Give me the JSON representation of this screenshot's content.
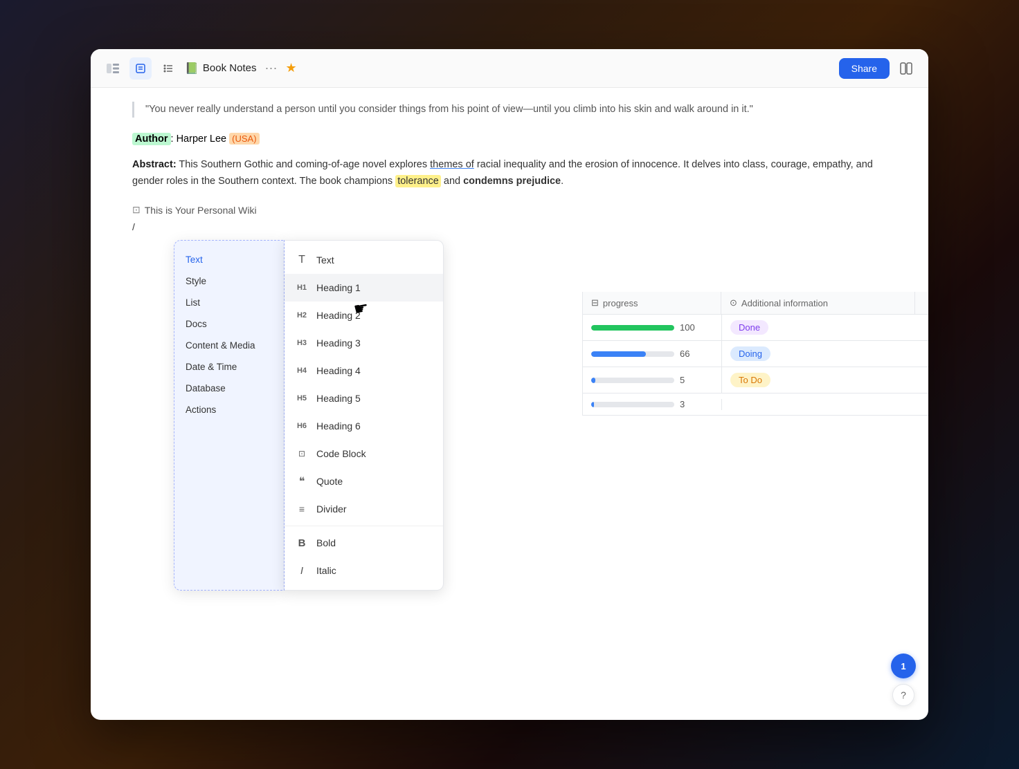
{
  "window": {
    "title": "Book Notes"
  },
  "titlebar": {
    "sidebar_toggle_label": "☰",
    "doc_icon": "📗",
    "doc_title": "Book Notes",
    "more_label": "···",
    "star_label": "★",
    "share_label": "Share",
    "layout_label": "⊡"
  },
  "content": {
    "quote_text": "\"You never really understand a person until you consider things from his point of view—until you climb into his skin and walk around in it.\"",
    "author_label": "Author",
    "author_name": "Harper Lee",
    "author_tag": "(USA)",
    "abstract_label": "Abstract",
    "abstract_text": "This Southern Gothic and coming-of-age novel explores themes of racial inequality and the erosion of innocence. It delves into class, courage, empathy, and gender roles in the Southern context. The book champions tolerance and condemns prejudice.",
    "themes_of": "themes of",
    "tolerance": "tolerance",
    "condemns_prejudice": "condemns prejudice",
    "wiki_ref_icon": "⊡",
    "wiki_ref_text": "This is Your Personal Wiki",
    "slash_command": "/"
  },
  "table": {
    "progress_col": "progress",
    "info_col": "Additional information",
    "rows": [
      {
        "progress": 100,
        "progress_color": "#22c55e",
        "status": "Done",
        "status_class": "badge-done"
      },
      {
        "progress": 66,
        "progress_color": "#3b82f6",
        "status": "Doing",
        "status_class": "badge-doing"
      },
      {
        "progress": 5,
        "progress_color": "#3b82f6",
        "status": "To Do",
        "status_class": "badge-todo"
      },
      {
        "progress": 3,
        "progress_color": "#3b82f6",
        "status": "",
        "status_class": ""
      }
    ]
  },
  "menu": {
    "categories": [
      {
        "id": "text",
        "label": "Text",
        "active": true
      },
      {
        "id": "style",
        "label": "Style",
        "active": false
      },
      {
        "id": "list",
        "label": "List",
        "active": false
      },
      {
        "id": "docs",
        "label": "Docs",
        "active": false
      },
      {
        "id": "content_media",
        "label": "Content & Media",
        "active": false
      },
      {
        "id": "date_time",
        "label": "Date & Time",
        "active": false
      },
      {
        "id": "database",
        "label": "Database",
        "active": false
      },
      {
        "id": "actions",
        "label": "Actions",
        "active": false
      }
    ],
    "items": [
      {
        "icon": "T",
        "label": "Text",
        "highlighted": false
      },
      {
        "icon": "H1",
        "label": "Heading 1",
        "highlighted": true
      },
      {
        "icon": "H2",
        "label": "Heading 2",
        "highlighted": false
      },
      {
        "icon": "H3",
        "label": "Heading 3",
        "highlighted": false
      },
      {
        "icon": "H4",
        "label": "Heading 4",
        "highlighted": false
      },
      {
        "icon": "H5",
        "label": "Heading 5",
        "highlighted": false
      },
      {
        "icon": "H6",
        "label": "Heading 6",
        "highlighted": false
      },
      {
        "icon": "{ }",
        "label": "Code Block",
        "highlighted": false
      },
      {
        "icon": "❝",
        "label": "Quote",
        "highlighted": false
      },
      {
        "icon": "—",
        "label": "Divider",
        "highlighted": false
      },
      {
        "divider": true
      },
      {
        "icon": "B",
        "label": "Bold",
        "highlighted": false
      },
      {
        "icon": "I",
        "label": "Italic",
        "highlighted": false
      }
    ]
  },
  "footer": {
    "help_label": "?",
    "notif_count": "1"
  }
}
